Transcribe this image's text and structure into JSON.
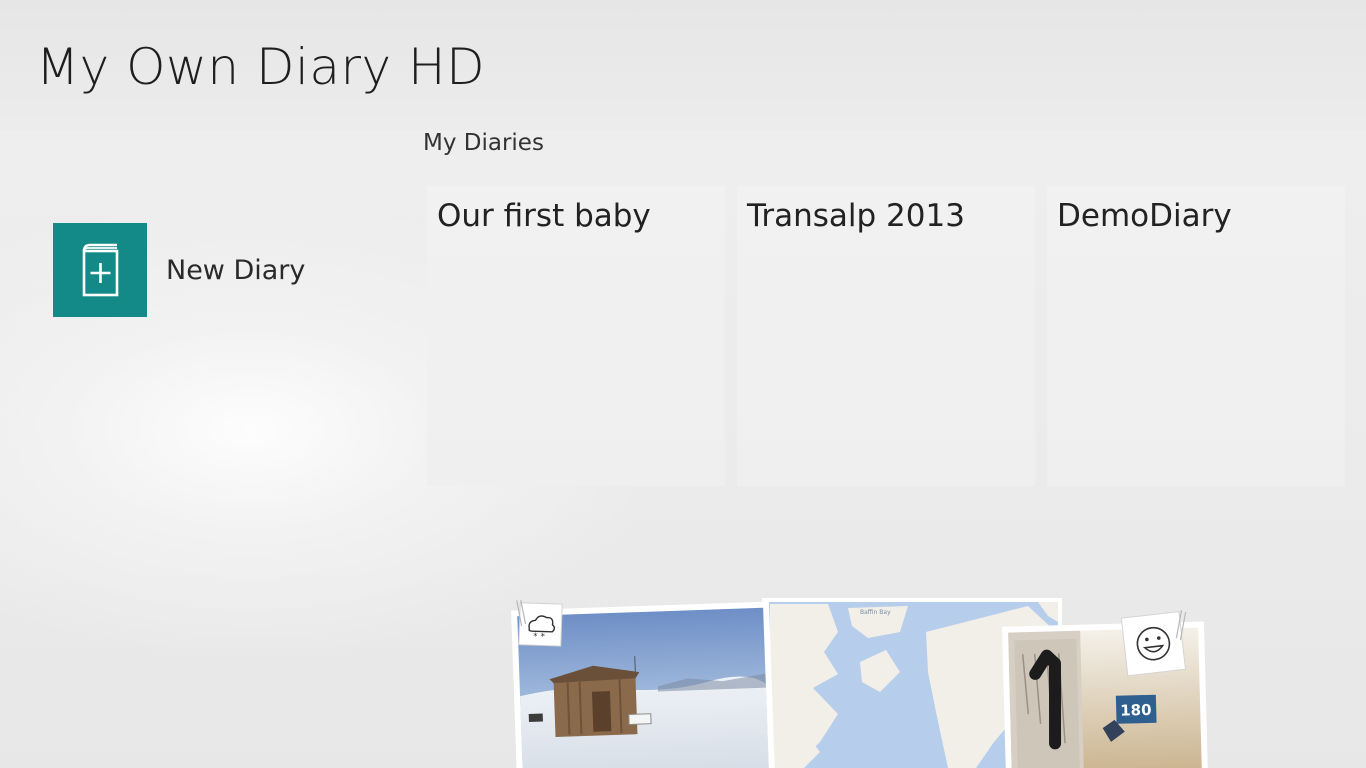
{
  "app": {
    "title": "My Own Diary HD"
  },
  "actions": {
    "new_diary_label": "New Diary"
  },
  "diaries": {
    "header": "My Diaries",
    "items": [
      {
        "title": "Our first baby"
      },
      {
        "title": "Transalp 2013"
      },
      {
        "title": "DemoDiary"
      }
    ]
  },
  "decor": {
    "map_label": "Baffin Bay",
    "beach_chair_number": "180",
    "weather_icon": "snow-cloud-icon",
    "mood_icon": "smiley-icon",
    "new_diary_icon": "book-plus-icon"
  },
  "colors": {
    "accent": "#138a88",
    "background": "#e9e9e9",
    "tile": "#f0f0f0"
  }
}
